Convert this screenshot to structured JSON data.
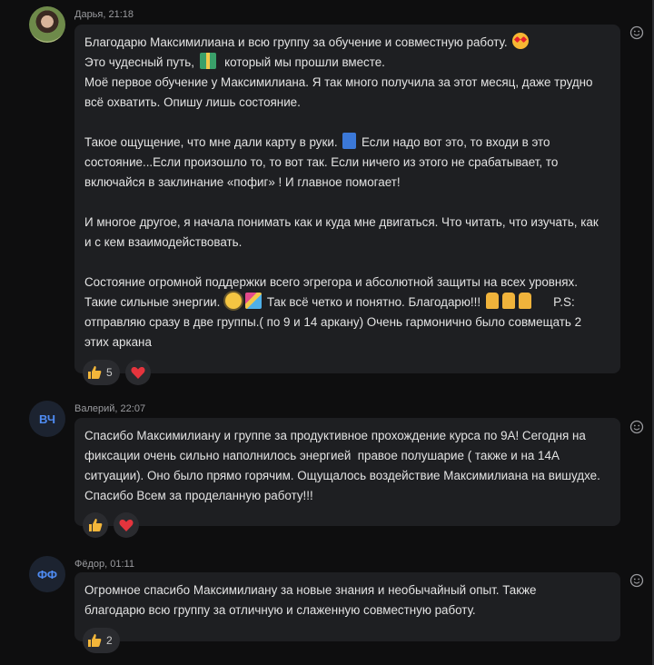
{
  "colors": {
    "background": "#0e0e0f",
    "bubble": "#1e1f22",
    "text": "#e3e3e3",
    "meta": "#9a9b9f",
    "avatar_initials": "#4f8cf3",
    "heart": "#e5343d",
    "thumb": "#f3b63a"
  },
  "messages": [
    {
      "author": "Дарья",
      "time": "21:18",
      "lines": [
        [
          "Благодарю Максимилиана и всю группу за обучение и совместную работу. ",
          "love-eyes-emoji",
          ""
        ],
        [
          "Это чудесный путь, ",
          "gift-emoji",
          "  который мы прошли вместе."
        ],
        [
          "Моё первое обучение у Максимилиана. Я так много получила за этот месяц, даже трудно",
          "",
          ""
        ],
        [
          "всё охватить. Опишу лишь состояние.",
          "",
          ""
        ],
        [
          "",
          "",
          ""
        ],
        [
          "Такое ощущение, что мне дали карту в руки. ",
          "book-emoji",
          " Если надо вот это, то входи в это"
        ],
        [
          "состояние...Если произошло то, то вот так. Если ничего из этого не срабатывает, то",
          "",
          ""
        ],
        [
          "включайся в заклинание «пофиг» ! И главное помогает!",
          "",
          ""
        ],
        [
          "",
          "",
          ""
        ],
        [
          "И многое другое, я начала понимать как и куда мне двигаться. Что читать, что изучать, как",
          "",
          ""
        ],
        [
          "и с кем взаимодействовать.",
          "",
          ""
        ],
        [
          "",
          "",
          ""
        ],
        [
          "Состояние огромной поддержки всего эгрегора и абсолютной защиты на всех уровнях.",
          "",
          ""
        ],
        [
          "Такие сильные энергии. ",
          "sun-emoji party-emoji",
          " Так всё четко и понятно. Благодарю!!! ",
          "pray-emoji pray-emoji pray-emoji",
          "      P.S:"
        ],
        [
          "отправляю сразу в две группы.( по 9 и 14 аркану) Очень гармонично было совмещать 2",
          "",
          ""
        ],
        [
          "этих аркана",
          "",
          ""
        ]
      ],
      "reactions": [
        {
          "icon": "thumbs-up-icon",
          "count": "5"
        },
        {
          "icon": "heart-icon",
          "count": ""
        }
      ]
    },
    {
      "author": "Валерий",
      "time": "22:07",
      "initials": "ВЧ",
      "lines": [
        "Спасибо Максимилиану и группе за продуктивное прохождение курса по 9А! Сегодня на",
        "фиксации очень сильно наполнилось энергией  правое полушарие ( также и на 14А",
        "ситуации). Оно было прямо горячим. Ощущалось воздействие Максимилиана на вишудхе.",
        "Спасибо Всем за проделанную работу!!!"
      ],
      "reactions": [
        {
          "icon": "thumbs-up-icon",
          "count": ""
        },
        {
          "icon": "heart-icon",
          "count": ""
        }
      ]
    },
    {
      "author": "Фёдор",
      "time": "01:11",
      "initials": "ФФ",
      "lines": [
        "Огромное спасибо Максимилиану за новые знания и необычайный опыт. Также",
        "благодарю всю группу за отличную и слаженную совместную работу."
      ],
      "reactions": [
        {
          "icon": "thumbs-up-icon",
          "count": "2"
        }
      ]
    }
  ]
}
